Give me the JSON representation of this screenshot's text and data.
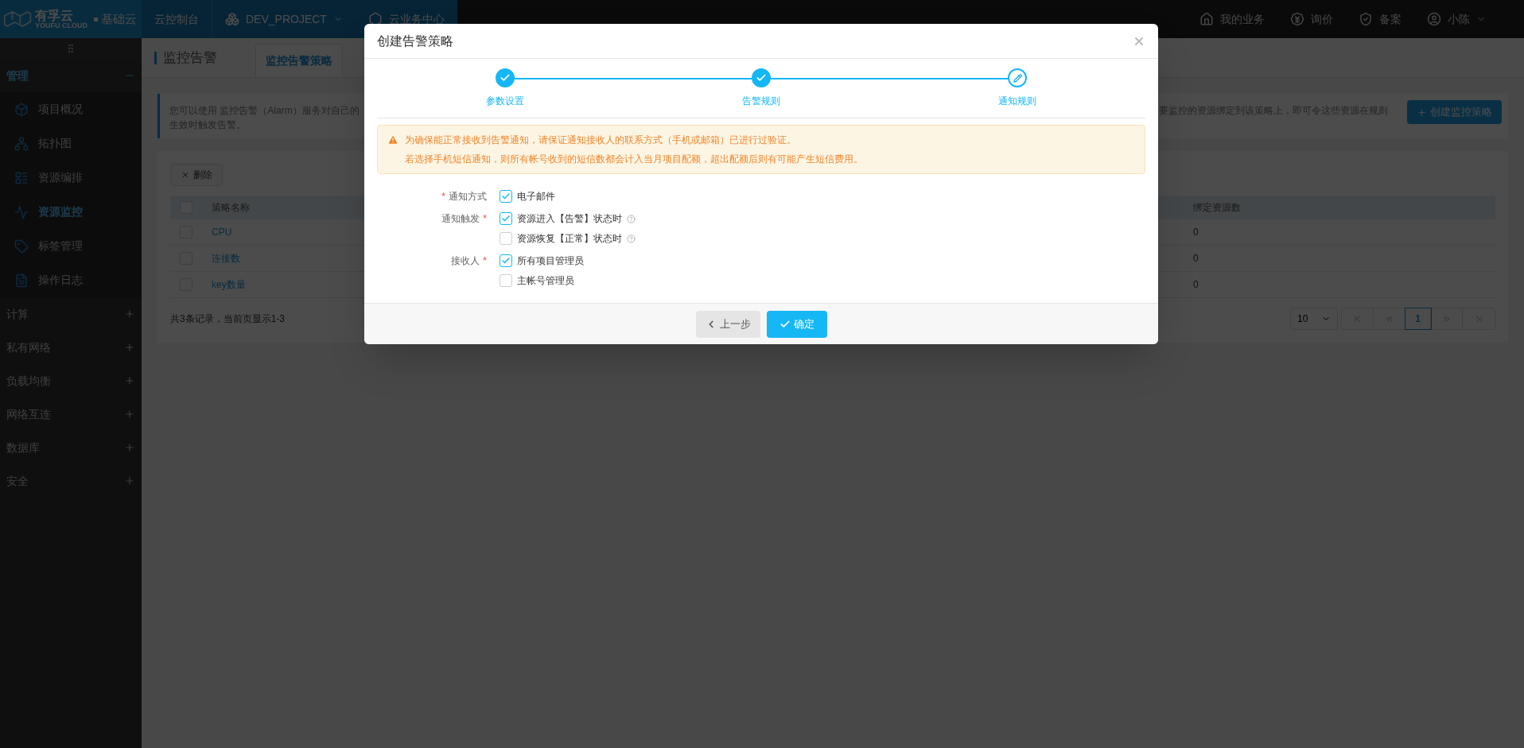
{
  "header": {
    "logo": {
      "brand": "有孚云",
      "sub": "YOUFU CLOUD",
      "product": "基础云"
    },
    "nav": [
      {
        "label": "云控制台",
        "kind": "console"
      },
      {
        "label": "DEV_PROJECT",
        "kind": "project"
      },
      {
        "label": "云业务中心",
        "kind": "center"
      }
    ],
    "right": [
      {
        "label": "我的业务",
        "kind": "business"
      },
      {
        "label": "询价",
        "kind": "price"
      },
      {
        "label": "备案",
        "kind": "icp"
      },
      {
        "label": "小陈",
        "kind": "user"
      }
    ]
  },
  "sidebar": {
    "sections": [
      {
        "label": "管理",
        "expanded": true,
        "children": [
          {
            "label": "项目概况",
            "selected": false
          },
          {
            "label": "拓扑图",
            "selected": false
          },
          {
            "label": "资源编排",
            "selected": false
          },
          {
            "label": "资源监控",
            "selected": true
          },
          {
            "label": "标签管理",
            "selected": false
          },
          {
            "label": "操作日志",
            "selected": false
          }
        ]
      },
      {
        "label": "计算",
        "expanded": false
      },
      {
        "label": "私有网络",
        "expanded": false
      },
      {
        "label": "负载均衡",
        "expanded": false
      },
      {
        "label": "网络互连",
        "expanded": false
      },
      {
        "label": "数据库",
        "expanded": false
      },
      {
        "label": "安全",
        "expanded": false
      }
    ]
  },
  "page": {
    "title": "监控告警",
    "tabs": [
      {
        "label": "监控告警策略",
        "selected": true
      }
    ],
    "info": {
      "left_lines": [
        "您可以使用 监控告警（Alarm）服务对自己的",
        "生效时触发告警。"
      ],
      "right_fragment": "要监控的资源绑定到该策略上，即可令这些资源在规则"
    },
    "create_button": "创建监控策略",
    "delete_button": "删除",
    "table": {
      "select_all_checked": false,
      "columns": [
        "策略名称",
        "绑定资源数"
      ],
      "rows": [
        {
          "name": "CPU",
          "bound": "0",
          "checked": false
        },
        {
          "name": "连接数",
          "bound": "0",
          "checked": false
        },
        {
          "name": "key数量",
          "bound": "0",
          "checked": false
        }
      ]
    },
    "summary": "共3条记录，当前页显示1-3",
    "page_size": "10",
    "pages": [
      {
        "label": "1",
        "selected": true
      }
    ]
  },
  "modal": {
    "title": "创建告警策略",
    "steps": [
      {
        "label": "参数设置",
        "done": true
      },
      {
        "label": "告警规则",
        "done": true
      },
      {
        "label": "通知规则",
        "done": false
      }
    ],
    "alert": [
      "为确保能正常接收到告警通知，请保证通知接收人的联系方式（手机或邮箱）已进行过验证。",
      "若选择手机短信通知，则所有帐号收到的短信数都会计入当月项目配额，超出配额后则有可能产生短信费用。"
    ],
    "fields": [
      {
        "label": "通知方式",
        "mark_before": "*",
        "options": [
          {
            "label": "电子邮件",
            "checked": true,
            "help": false
          }
        ]
      },
      {
        "label": "通知触发",
        "mark_after": "*",
        "options": [
          {
            "label": "资源进入【告警】状态时",
            "checked": true,
            "help": true
          },
          {
            "label": "资源恢复【正常】状态时",
            "checked": false,
            "help": true
          }
        ]
      },
      {
        "label": "接收人",
        "mark_after": "*",
        "options": [
          {
            "label": "所有项目管理员",
            "checked": true,
            "help": false
          },
          {
            "label": "主帐号管理员",
            "checked": false,
            "help": false
          }
        ]
      }
    ],
    "buttons": [
      {
        "label": "上一步",
        "kind": "back"
      },
      {
        "label": "确定",
        "kind": "confirm"
      }
    ]
  }
}
